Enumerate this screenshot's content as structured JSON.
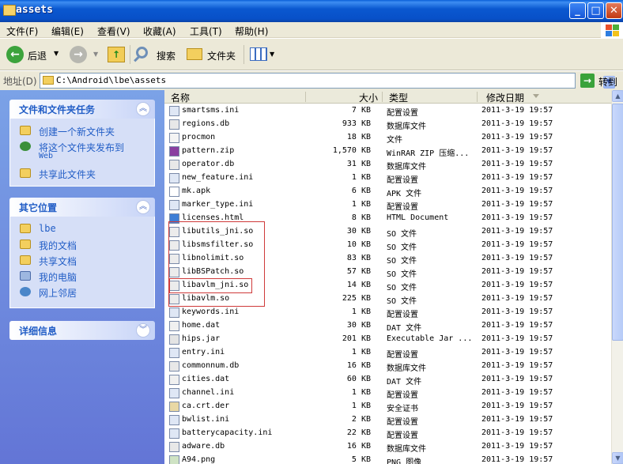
{
  "window": {
    "title": "assets"
  },
  "menu": [
    "文件(F)",
    "编辑(E)",
    "查看(V)",
    "收藏(A)",
    "工具(T)",
    "帮助(H)"
  ],
  "toolbar": {
    "back": "后退",
    "search": "搜索",
    "folders": "文件夹"
  },
  "address": {
    "label": "地址(D)",
    "path": "C:\\Android\\lbe\\assets",
    "go": "转到"
  },
  "left_panels": {
    "tasks": {
      "title": "文件和文件夹任务",
      "items": [
        {
          "label": "创建一个新文件夹"
        },
        {
          "label": "将这个文件夹发布到",
          "sub": "Web"
        },
        {
          "label": "共享此文件夹"
        }
      ]
    },
    "places": {
      "title": "其它位置",
      "items": [
        {
          "label": "lbe"
        },
        {
          "label": "我的文档"
        },
        {
          "label": "共享文档"
        },
        {
          "label": "我的电脑"
        },
        {
          "label": "网上邻居"
        }
      ]
    },
    "details": {
      "title": "详细信息"
    }
  },
  "columns": {
    "name": "名称",
    "size": "大小",
    "type": "类型",
    "modified": "修改日期"
  },
  "files": [
    {
      "name": "smartsms.ini",
      "size": "7 KB",
      "type": "配置设置",
      "date": "2011-3-19 19:57"
    },
    {
      "name": "regions.db",
      "size": "933 KB",
      "type": "数据库文件",
      "date": "2011-3-19 19:57"
    },
    {
      "name": "procmon",
      "size": "18 KB",
      "type": "文件",
      "date": "2011-3-19 19:57"
    },
    {
      "name": "pattern.zip",
      "size": "1,570 KB",
      "type": "WinRAR ZIP 压缩...",
      "date": "2011-3-19 19:57"
    },
    {
      "name": "operator.db",
      "size": "31 KB",
      "type": "数据库文件",
      "date": "2011-3-19 19:57"
    },
    {
      "name": "new_feature.ini",
      "size": "1 KB",
      "type": "配置设置",
      "date": "2011-3-19 19:57"
    },
    {
      "name": "mk.apk",
      "size": "6 KB",
      "type": "APK 文件",
      "date": "2011-3-19 19:57"
    },
    {
      "name": "marker_type.ini",
      "size": "1 KB",
      "type": "配置设置",
      "date": "2011-3-19 19:57"
    },
    {
      "name": "licenses.html",
      "size": "8 KB",
      "type": "HTML Document",
      "date": "2011-3-19 19:57"
    },
    {
      "name": "libutils_jni.so",
      "size": "30 KB",
      "type": "SO 文件",
      "date": "2011-3-19 19:57"
    },
    {
      "name": "libsmsfilter.so",
      "size": "10 KB",
      "type": "SO 文件",
      "date": "2011-3-19 19:57"
    },
    {
      "name": "libnolimit.so",
      "size": "83 KB",
      "type": "SO 文件",
      "date": "2011-3-19 19:57"
    },
    {
      "name": "libBSPatch.so",
      "size": "57 KB",
      "type": "SO 文件",
      "date": "2011-3-19 19:57"
    },
    {
      "name": "libavlm_jni.so",
      "size": "14 KB",
      "type": "SO 文件",
      "date": "2011-3-19 19:57"
    },
    {
      "name": "libavlm.so",
      "size": "225 KB",
      "type": "SO 文件",
      "date": "2011-3-19 19:57"
    },
    {
      "name": "keywords.ini",
      "size": "1 KB",
      "type": "配置设置",
      "date": "2011-3-19 19:57"
    },
    {
      "name": "home.dat",
      "size": "30 KB",
      "type": "DAT 文件",
      "date": "2011-3-19 19:57"
    },
    {
      "name": "hips.jar",
      "size": "201 KB",
      "type": "Executable Jar ...",
      "date": "2011-3-19 19:57"
    },
    {
      "name": "entry.ini",
      "size": "1 KB",
      "type": "配置设置",
      "date": "2011-3-19 19:57"
    },
    {
      "name": "commonnum.db",
      "size": "16 KB",
      "type": "数据库文件",
      "date": "2011-3-19 19:57"
    },
    {
      "name": "cities.dat",
      "size": "60 KB",
      "type": "DAT 文件",
      "date": "2011-3-19 19:57"
    },
    {
      "name": "channel.ini",
      "size": "1 KB",
      "type": "配置设置",
      "date": "2011-3-19 19:57"
    },
    {
      "name": "ca.crt.der",
      "size": "1 KB",
      "type": "安全证书",
      "date": "2011-3-19 19:57"
    },
    {
      "name": "bwlist.ini",
      "size": "2 KB",
      "type": "配置设置",
      "date": "2011-3-19 19:57"
    },
    {
      "name": "batterycapacity.ini",
      "size": "22 KB",
      "type": "配置设置",
      "date": "2011-3-19 19:57"
    },
    {
      "name": "adware.db",
      "size": "16 KB",
      "type": "数据库文件",
      "date": "2011-3-19 19:57"
    },
    {
      "name": "A94.png",
      "size": "5 KB",
      "type": "PNG 图像",
      "date": "2011-3-19 19:57"
    }
  ]
}
